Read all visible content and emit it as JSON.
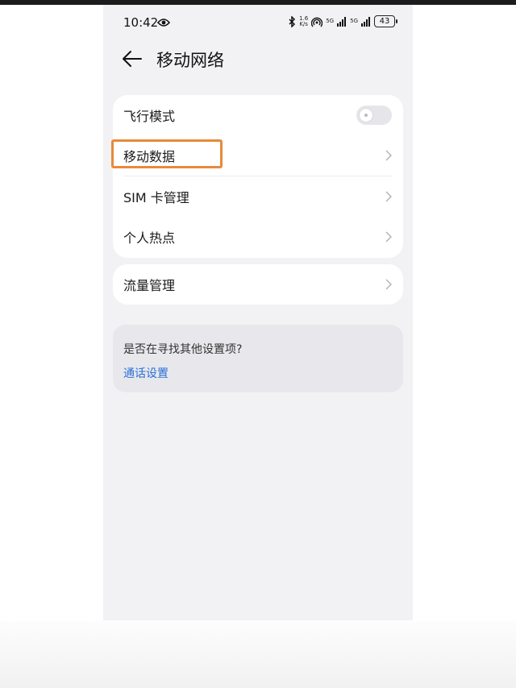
{
  "status_bar": {
    "time": "10:42",
    "speed_value": "1.6",
    "speed_unit": "K/s",
    "signal_1": "5G",
    "signal_2": "5G",
    "battery": "43"
  },
  "header": {
    "title": "移动网络"
  },
  "section1": {
    "items": [
      {
        "label": "飞行模式",
        "type": "toggle",
        "on": false
      },
      {
        "label": "移动数据",
        "type": "chevron"
      },
      {
        "label": "SIM 卡管理",
        "type": "chevron"
      },
      {
        "label": "个人热点",
        "type": "chevron"
      }
    ]
  },
  "section2": {
    "items": [
      {
        "label": "流量管理",
        "type": "chevron"
      }
    ]
  },
  "hint": {
    "question": "是否在寻找其他设置项?",
    "link": "通话设置"
  },
  "colors": {
    "highlight": "#e88a3a",
    "link": "#2a6fd6",
    "background": "#f2f2f5"
  }
}
